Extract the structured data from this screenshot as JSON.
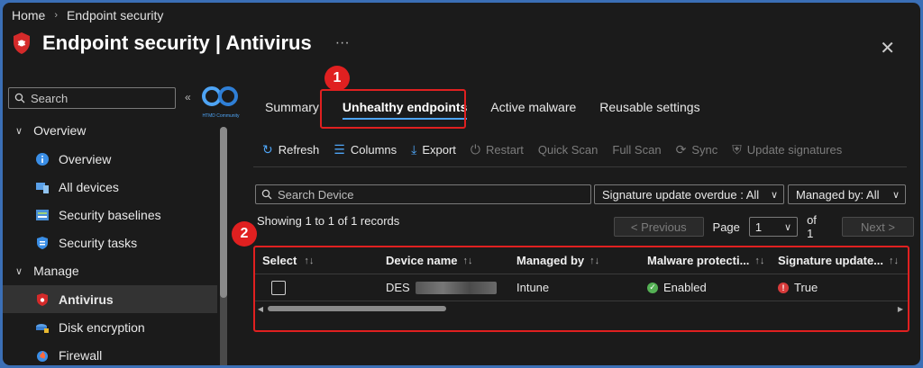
{
  "breadcrumb": {
    "home": "Home",
    "current": "Endpoint security"
  },
  "title": "Endpoint security | Antivirus",
  "more_label": "···",
  "close_label": "✕",
  "sidebar": {
    "search_placeholder": "Search",
    "brand_text": "HTMD Community",
    "groups": [
      {
        "label": "Overview",
        "items": [
          {
            "label": "Overview",
            "icon": "info-icon"
          },
          {
            "label": "All devices",
            "icon": "devices-icon"
          },
          {
            "label": "Security baselines",
            "icon": "baselines-icon"
          },
          {
            "label": "Security tasks",
            "icon": "tasks-icon"
          }
        ]
      },
      {
        "label": "Manage",
        "items": [
          {
            "label": "Antivirus",
            "icon": "antivirus-shield-icon",
            "active": true
          },
          {
            "label": "Disk encryption",
            "icon": "disk-encryption-icon"
          },
          {
            "label": "Firewall",
            "icon": "firewall-icon"
          }
        ]
      }
    ]
  },
  "tabs": [
    {
      "label": "Summary"
    },
    {
      "label": "Unhealthy endpoints",
      "active": true
    },
    {
      "label": "Active malware"
    },
    {
      "label": "Reusable settings"
    }
  ],
  "annotations": {
    "one": "1",
    "two": "2"
  },
  "toolbar": {
    "refresh": "Refresh",
    "columns": "Columns",
    "export": "Export",
    "restart": "Restart",
    "quick_scan": "Quick Scan",
    "full_scan": "Full Scan",
    "sync": "Sync",
    "update_signatures": "Update signatures"
  },
  "filters": {
    "search_placeholder": "Search Device",
    "signature_overdue": "Signature update overdue : All",
    "managed_by": "Managed by: All"
  },
  "records_text": "Showing 1 to 1 of 1 records",
  "pager": {
    "prev": "< Previous",
    "page_label": "Page",
    "page_value": "1",
    "of_label": "of 1",
    "next": "Next >"
  },
  "grid": {
    "headers": [
      "Select",
      "Device name",
      "Managed by",
      "Malware protecti...",
      "Signature update..."
    ],
    "rows": [
      {
        "device": "DES",
        "managed_by": "Intune",
        "malware_protection": "Enabled",
        "signature_update": "True"
      }
    ]
  },
  "colors": {
    "accent": "#4ea4f5",
    "highlight": "#e02020",
    "ok": "#54b054",
    "error": "#d83b3b"
  }
}
